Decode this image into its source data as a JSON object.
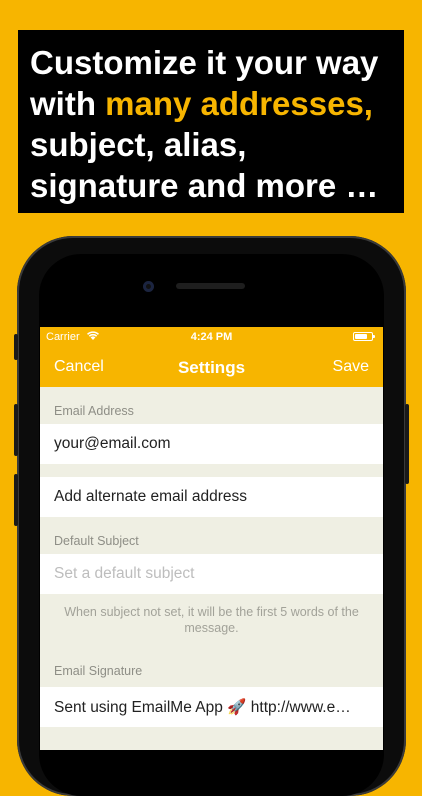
{
  "headline": {
    "line1": "Customize it your way",
    "line2_prefix": "with ",
    "line2_highlight": "many addresses,",
    "line3": "subject, alias,",
    "line4": "signature and more …"
  },
  "colors": {
    "accent": "#F7B500",
    "headline_bg": "#000000",
    "table_bg": "#EFEFE3"
  },
  "status_bar": {
    "carrier": "Carrier",
    "time": "4:24 PM"
  },
  "nav": {
    "cancel": "Cancel",
    "title": "Settings",
    "save": "Save"
  },
  "email_section": {
    "header": "Email Address",
    "address": "your@email.com",
    "add_alternate": "Add alternate email address"
  },
  "subject_section": {
    "header": "Default Subject",
    "placeholder": "Set a default subject",
    "footer": "When subject not set, it will be the first 5 words of the message."
  },
  "signature_section": {
    "header": "Email Signature",
    "value": "Sent using EmailMe App 🚀 http://www.e…"
  }
}
